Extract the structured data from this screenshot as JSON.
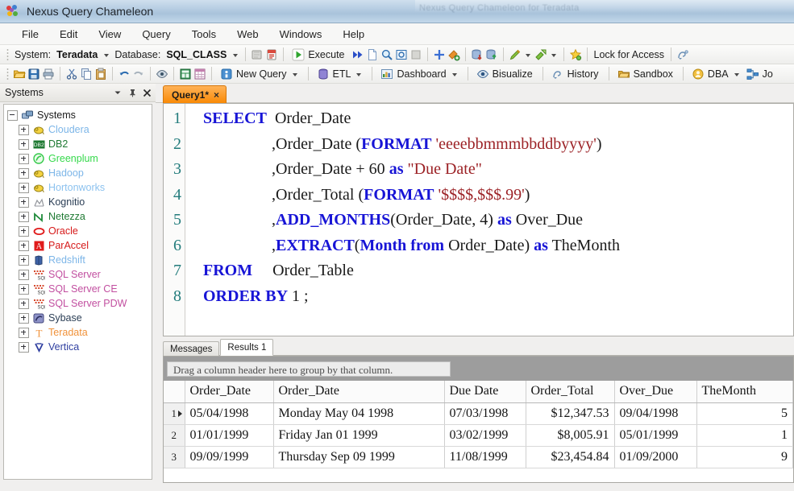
{
  "window": {
    "title": "Nexus Query Chameleon",
    "background_ghost_text": "Nexus Query Chameleon for Teradata"
  },
  "menu": {
    "items": [
      "File",
      "Edit",
      "View",
      "Query",
      "Tools",
      "Web",
      "Windows",
      "Help"
    ]
  },
  "connection_bar": {
    "system_label": "System:",
    "system_value": "Teradata",
    "database_label": "Database:",
    "database_value": "SQL_CLASS",
    "execute_label": "Execute",
    "lock_label": "Lock for Access"
  },
  "toolbar": {
    "new_query_label": "New Query",
    "etl_label": "ETL",
    "dashboard_label": "Dashboard",
    "bisualize_label": "Bisualize",
    "history_label": "History",
    "sandbox_label": "Sandbox",
    "dba_label": "DBA",
    "jobs_label": "Jo",
    "icons_row1": [
      "open-folder-icon",
      "save-icon",
      "print-icon",
      "cut-icon",
      "copy-icon",
      "paste-icon",
      "undo-icon",
      "redo-icon",
      "preview-icon",
      "spreadsheet-icon",
      "table-grid-icon"
    ],
    "icons_row2": [
      "stop-icon",
      "explain-icon",
      "fast-forward-icon",
      "new-doc-icon",
      "zoom-icon",
      "window-icon",
      "blank-icon",
      "plus-icon",
      "add-object-icon",
      "db-down-icon",
      "db-up-icon",
      "pencil-icon",
      "export-icon",
      "star-icon"
    ]
  },
  "sidebar": {
    "title": "Systems",
    "header_icons": [
      "chevron-down-icon",
      "pin-icon",
      "close-icon"
    ],
    "root": {
      "label": "Systems",
      "icon": "servers-icon"
    },
    "items": [
      {
        "label": "Cloudera",
        "icon": "elephant-icon",
        "color": "#7db6e8"
      },
      {
        "label": "DB2",
        "icon": "db2-icon",
        "color": "#1f7a33"
      },
      {
        "label": "Greenplum",
        "icon": "greenplum-icon",
        "color": "#35d94b"
      },
      {
        "label": "Hadoop",
        "icon": "elephant-icon",
        "color": "#7db6e8"
      },
      {
        "label": "Hortonworks",
        "icon": "elephant-icon",
        "color": "#8cc2ef"
      },
      {
        "label": "Kognitio",
        "icon": "kognitio-icon",
        "color": "#2b3e55"
      },
      {
        "label": "Netezza",
        "icon": "netezza-icon",
        "color": "#1f7a33"
      },
      {
        "label": "Oracle",
        "icon": "oracle-icon",
        "color": "#d61919"
      },
      {
        "label": "ParAccel",
        "icon": "paraccel-icon",
        "color": "#d61919"
      },
      {
        "label": "Redshift",
        "icon": "redshift-icon",
        "color": "#7db6e8"
      },
      {
        "label": "SQL Server",
        "icon": "sqlserver-icon",
        "color": "#c24fa0"
      },
      {
        "label": "SQL Server CE",
        "icon": "sqlserver-icon",
        "color": "#c24fa0"
      },
      {
        "label": "SQL Server PDW",
        "icon": "sqlserver-icon",
        "color": "#c24fa0"
      },
      {
        "label": "Sybase",
        "icon": "sybase-icon",
        "color": "#2b3e55"
      },
      {
        "label": "Teradata",
        "icon": "teradata-icon",
        "color": "#f0923a"
      },
      {
        "label": "Vertica",
        "icon": "vertica-icon",
        "color": "#2f3fa0"
      }
    ]
  },
  "query_tab": {
    "label": "Query1*",
    "close": "×"
  },
  "editor": {
    "line_numbers": [
      "1",
      "2",
      "3",
      "4",
      "5",
      "6",
      "7",
      "8"
    ],
    "lines": [
      [
        {
          "t": "SELECT",
          "c": "kw"
        },
        {
          "t": "  Order_Date",
          "c": "pl"
        }
      ],
      [
        {
          "t": "                 ,Order_Date (",
          "c": "pl"
        },
        {
          "t": "FORMAT",
          "c": "kw"
        },
        {
          "t": " ",
          "c": "pl"
        },
        {
          "t": "'eeeebbmmmbbddbyyyy'",
          "c": "str"
        },
        {
          "t": ")",
          "c": "pl"
        }
      ],
      [
        {
          "t": "                 ,Order_Date + 60 ",
          "c": "pl"
        },
        {
          "t": "as",
          "c": "kw"
        },
        {
          "t": " ",
          "c": "pl"
        },
        {
          "t": "\"Due Date\"",
          "c": "alias"
        }
      ],
      [
        {
          "t": "                 ,Order_Total (",
          "c": "pl"
        },
        {
          "t": "FORMAT",
          "c": "kw"
        },
        {
          "t": " ",
          "c": "pl"
        },
        {
          "t": "'$$$$,$$$.99'",
          "c": "str"
        },
        {
          "t": ")",
          "c": "pl"
        }
      ],
      [
        {
          "t": "                 ,",
          "c": "pl"
        },
        {
          "t": "ADD_MONTHS",
          "c": "kw"
        },
        {
          "t": "(Order_Date, 4) ",
          "c": "pl"
        },
        {
          "t": "as",
          "c": "kw"
        },
        {
          "t": " Over_Due",
          "c": "pl"
        }
      ],
      [
        {
          "t": "                 ,",
          "c": "pl"
        },
        {
          "t": "EXTRACT",
          "c": "kw"
        },
        {
          "t": "(",
          "c": "pl"
        },
        {
          "t": "Month from",
          "c": "kw"
        },
        {
          "t": " Order_Date) ",
          "c": "pl"
        },
        {
          "t": "as",
          "c": "kw"
        },
        {
          "t": " TheMonth",
          "c": "pl"
        }
      ],
      [
        {
          "t": "FROM",
          "c": "kw"
        },
        {
          "t": "     Order_Table",
          "c": "pl"
        }
      ],
      [
        {
          "t": "ORDER BY",
          "c": "kw"
        },
        {
          "t": " 1 ;",
          "c": "pl"
        }
      ]
    ]
  },
  "results": {
    "tabs": [
      {
        "label": "Messages",
        "active": false
      },
      {
        "label": "Results 1",
        "active": true
      }
    ],
    "group_hint": "Drag a column header here to group by that column.",
    "columns": [
      "Order_Date",
      "Order_Date",
      "Due Date",
      "Order_Total",
      "Over_Due",
      "TheMonth"
    ],
    "rows": [
      {
        "index": "1",
        "current": true,
        "cells": [
          "05/04/1998",
          "Monday  May  04 1998",
          "07/03/1998",
          "$12,347.53",
          "09/04/1998",
          "5"
        ]
      },
      {
        "index": "2",
        "current": false,
        "cells": [
          "01/01/1999",
          "Friday  Jan  01 1999",
          "03/02/1999",
          "$8,005.91",
          "05/01/1999",
          "1"
        ]
      },
      {
        "index": "3",
        "current": false,
        "cells": [
          "09/09/1999",
          "Thursday  Sep  09 1999",
          "11/08/1999",
          "$23,454.84",
          "01/09/2000",
          "9"
        ]
      }
    ]
  },
  "colors": {
    "keyword": "#1714d6",
    "string": "#9c2226",
    "line_number": "#237c7c",
    "tab_accent": "#f98a06"
  }
}
